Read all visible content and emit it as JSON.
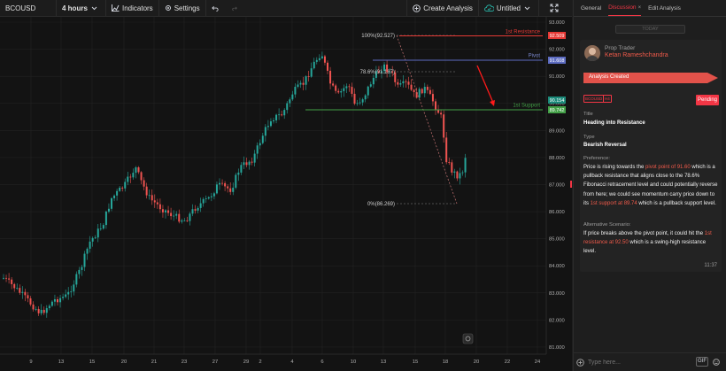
{
  "toolbar": {
    "symbol": "BCOUSD",
    "interval": "4 hours",
    "indicators": "Indicators",
    "settings": "Settings",
    "create_analysis": "Create Analysis",
    "untitled": "Untitled"
  },
  "chart": {
    "price_levels": [
      "93.000",
      "92.000",
      "91.000",
      "90.000",
      "89.000",
      "88.000",
      "87.000",
      "86.000",
      "85.000",
      "84.000",
      "83.000",
      "82.000",
      "81.000"
    ],
    "x_labels": [
      "9",
      "13",
      "15",
      "20",
      "21",
      "23",
      "27",
      "29",
      "2",
      "4",
      "6",
      "10",
      "13",
      "15",
      "18",
      "20",
      "22",
      "24"
    ],
    "fib_labels": [
      "100%(92.527)",
      "78.6%(91.187)",
      "0%(86.269)"
    ],
    "lines": {
      "resistance_label": "1st Resistance",
      "resistance_value": "92.509",
      "pivot_label": "Pivot",
      "pivot_value": "91.608",
      "support_label": "1st Support",
      "support_value": "89.742",
      "last_price": "90.154"
    },
    "colors": {
      "up": "#26a69a",
      "down": "#ef5350",
      "resistance": "#e53935",
      "pivot": "#5c6bc0",
      "support": "#43a047",
      "arrow": "#ff1a1a"
    }
  },
  "side": {
    "tabs": [
      "General",
      "Discussion",
      "Edit Analysis"
    ],
    "today": "TODAY",
    "role": "Prop Trader",
    "name": "Ketan Rameshchandra",
    "created": "Analysis Created",
    "tags": [
      "BCOUSD",
      "H4"
    ],
    "status": "Pending",
    "title_label": "Title",
    "title_value": "Heading into Resistance",
    "type_label": "Type",
    "type_value": "Bearish Reversal",
    "pref_label": "Preference:",
    "pref_1": "Price is rising towards the ",
    "pref_hl1": "pivot point of 91.60",
    "pref_2": " which is a pullback resistance that aligns close to the 78.6% Fibonacci retracement level and could potentially reverse from here; we could see momentum carry price down to its ",
    "pref_hl2": "1st support at 89.74",
    "pref_3": " which is a pullback support level.",
    "alt_label": "Alternative Scenario:",
    "alt_1": "If price breaks above the pivot point, it could hit the ",
    "alt_hl": "1st resistance at 92.50",
    "alt_2": " which is a swing-high resistance level.",
    "time": "11:37",
    "placeholder": "Type here...",
    "gif": "GIF"
  }
}
